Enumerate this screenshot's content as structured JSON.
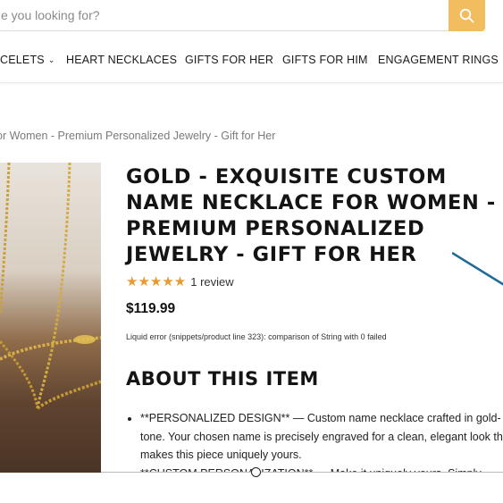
{
  "search": {
    "placeholder": "e you looking for?"
  },
  "nav": {
    "items": [
      {
        "label": "CELETS",
        "has_dropdown": true
      },
      {
        "label": "HEART NECKLACES"
      },
      {
        "label": "GIFTS FOR HER"
      },
      {
        "label": "GIFTS FOR HIM"
      },
      {
        "label": "ENGAGEMENT RINGS"
      }
    ],
    "chevron": "⌄"
  },
  "breadcrumb": "or Women - Premium Personalized Jewelry - Gift for Her",
  "product": {
    "title": "GOLD - EXQUISITE CUSTOM NAME NECKLACE FOR WOMEN - PREMIUM PERSONALIZED JEWELRY - GIFT FOR HER",
    "stars": "★★★★★",
    "review_count": "1 review",
    "price": "$119.99",
    "liquid_error": "Liquid error (snippets/product line 323): comparison of String with 0 failed",
    "about_heading": "ABOUT THIS ITEM",
    "bullets": [
      "**PERSONALIZED DESIGN** — Custom name necklace crafted in gold-tone. Your chosen name is precisely engraved for a clean, elegant look that makes this piece uniquely yours.",
      "**CUSTOM PERSONALIZATION** — Make it uniquely yours. Simply"
    ]
  },
  "colors": {
    "accent": "#f2bd5e",
    "stars": "#e99a2c",
    "annotation": "#1f6a96"
  },
  "icons": [
    "search-icon",
    "chevron-down-icon",
    "star-icon"
  ]
}
